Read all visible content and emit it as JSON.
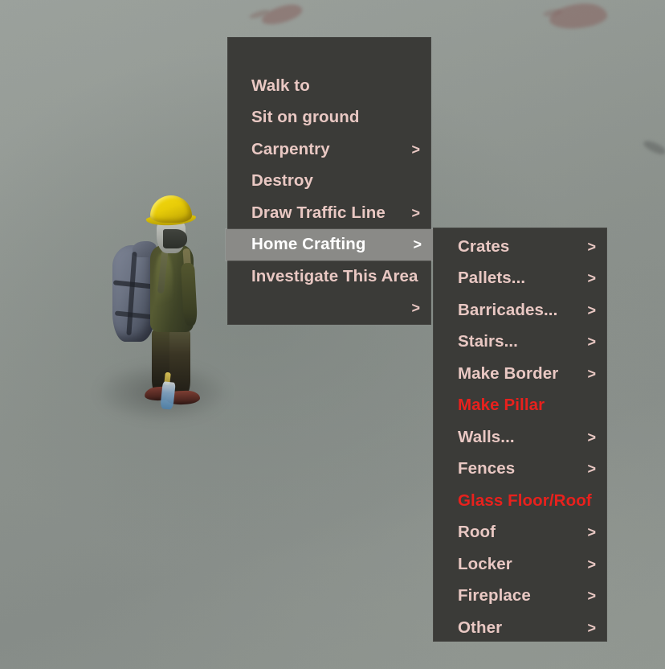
{
  "scene": {
    "description": "isometric survival game ground with character",
    "ground_color": "#8e9490",
    "stain_color": "#886864",
    "character": {
      "helmet_color": "#f0d40a",
      "jacket_color": "#4b4d2c",
      "backpack_color": "#6d7484",
      "boots_color": "#7a3b32"
    }
  },
  "context_menu": {
    "name": "radial-context-menu",
    "background": "#3b3b38",
    "text_color": "#e9c8c3",
    "disabled_color": "#e8211d",
    "highlight_color": "#8a8a87",
    "highlight_text_color": "#ffffff",
    "items": [
      {
        "label": "Walk to",
        "submenu": false,
        "state": "normal"
      },
      {
        "label": "Sit on ground",
        "submenu": false,
        "state": "normal"
      },
      {
        "label": "Carpentry",
        "submenu": true,
        "state": "normal"
      },
      {
        "label": "Destroy",
        "submenu": false,
        "state": "normal"
      },
      {
        "label": "Draw Traffic Line",
        "submenu": true,
        "state": "normal"
      },
      {
        "label": "Home Crafting",
        "submenu": true,
        "state": "selected"
      },
      {
        "label": "Investigate This Area",
        "submenu": false,
        "state": "normal"
      },
      {
        "label": "",
        "submenu": true,
        "state": "normal"
      }
    ]
  },
  "submenu": {
    "name": "home-crafting-submenu",
    "parent": "Home Crafting",
    "items": [
      {
        "label": "Crates",
        "submenu": true,
        "state": "normal"
      },
      {
        "label": "Pallets...",
        "submenu": true,
        "state": "normal"
      },
      {
        "label": "Barricades...",
        "submenu": true,
        "state": "normal"
      },
      {
        "label": "Stairs...",
        "submenu": true,
        "state": "normal"
      },
      {
        "label": "Make Border",
        "submenu": true,
        "state": "normal"
      },
      {
        "label": "Make Pillar",
        "submenu": false,
        "state": "disabled"
      },
      {
        "label": "Walls...",
        "submenu": true,
        "state": "normal"
      },
      {
        "label": "Fences",
        "submenu": true,
        "state": "normal"
      },
      {
        "label": "Glass Floor/Roof",
        "submenu": false,
        "state": "disabled"
      },
      {
        "label": "Roof",
        "submenu": true,
        "state": "normal"
      },
      {
        "label": "Locker",
        "submenu": true,
        "state": "normal"
      },
      {
        "label": "Fireplace",
        "submenu": true,
        "state": "normal"
      },
      {
        "label": "Other",
        "submenu": true,
        "state": "normal"
      }
    ]
  },
  "icons": {
    "submenu_arrow": ">"
  }
}
